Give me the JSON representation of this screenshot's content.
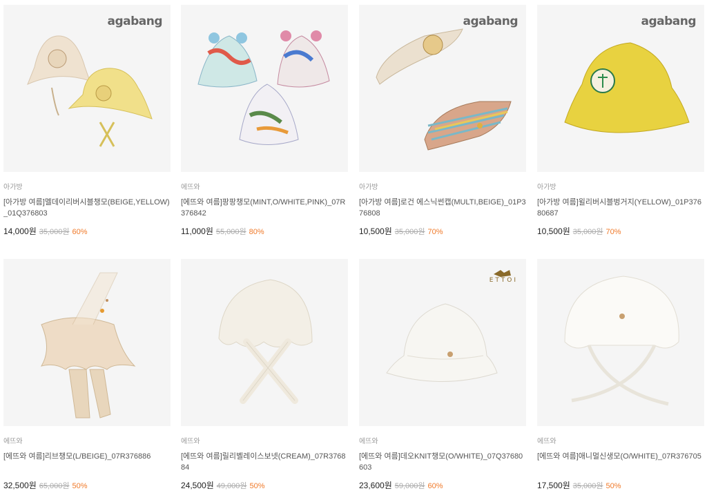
{
  "products": [
    {
      "brand": "아가방",
      "title": "[아가방 여름]멜데이리버시블챙모(BEIGE,YELLOW)_01Q376803",
      "price": "14,000원",
      "original_price": "35,000원",
      "discount": "60%",
      "logo": "agabang"
    },
    {
      "brand": "에뜨와",
      "title": "[에뜨와 여름]팡팡챙모(MINT,O/WHITE,PINK)_07R376842",
      "price": "11,000원",
      "original_price": "55,000원",
      "discount": "80%",
      "logo": ""
    },
    {
      "brand": "아가방",
      "title": "[아가방 여름]로건 에스닉썬캡(MULTI,BEIGE)_01P376808",
      "price": "10,500원",
      "original_price": "35,000원",
      "discount": "70%",
      "logo": "agabang"
    },
    {
      "brand": "아가방",
      "title": "[아가방 여름]윌리버시블벙거지(YELLOW)_01P37680687",
      "price": "10,500원",
      "original_price": "35,000원",
      "discount": "70%",
      "logo": "agabang"
    },
    {
      "brand": "에뜨와",
      "title": "[에뜨와 여름]리브챙모(L/BEIGE)_07R376886",
      "price": "32,500원",
      "original_price": "65,000원",
      "discount": "50%",
      "logo": ""
    },
    {
      "brand": "에뜨와",
      "title": "[에뜨와 여름]릴리벨레이스보넷(CREAM)_07R376884",
      "price": "24,500원",
      "original_price": "49,000원",
      "discount": "50%",
      "logo": ""
    },
    {
      "brand": "에뜨와",
      "title": "[에뜨와 여름]데오KNIT챙모(O/WHITE)_07Q37680603",
      "price": "23,600원",
      "original_price": "59,000원",
      "discount": "60%",
      "logo": "ETTOI"
    },
    {
      "brand": "에뜨와",
      "title": "[에뜨와 여름]애니멀신생모(O/WHITE)_07R376705",
      "price": "17,500원",
      "original_price": "35,000원",
      "discount": "50%",
      "logo": ""
    }
  ],
  "colors": {
    "discount": "#f07a2a",
    "thumb_bg": "#f5f5f5"
  }
}
